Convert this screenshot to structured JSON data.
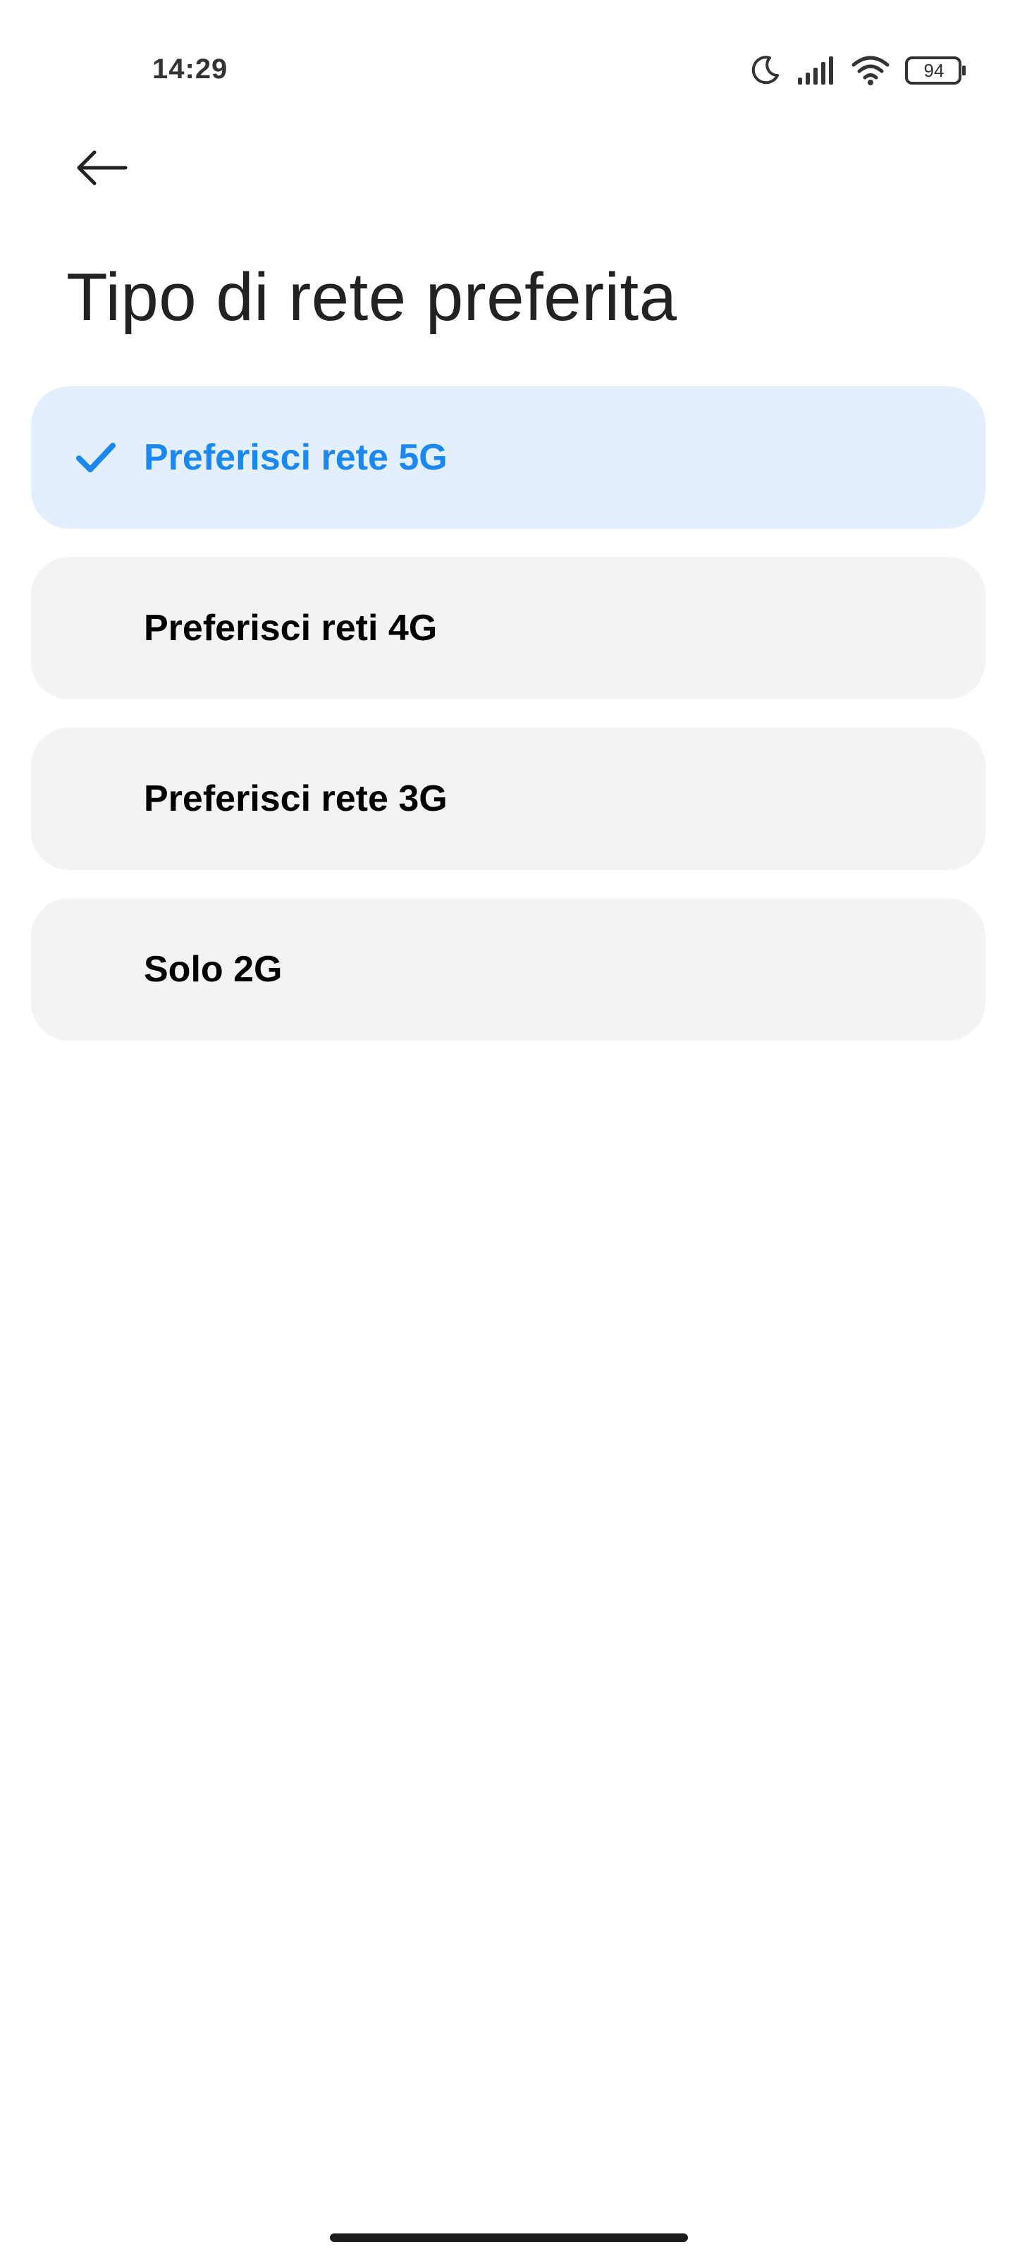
{
  "status_bar": {
    "time": "14:29",
    "battery_level": "94",
    "icons": [
      "moon-icon",
      "signal-icon",
      "wifi-icon",
      "battery-icon"
    ]
  },
  "header": {
    "back_icon": "arrow-left-icon",
    "title": "Tipo di rete preferita"
  },
  "options": [
    {
      "label": "Preferisci rete 5G",
      "selected": true
    },
    {
      "label": "Preferisci reti 4G",
      "selected": false
    },
    {
      "label": "Preferisci rete 3G",
      "selected": false
    },
    {
      "label": "Solo 2G",
      "selected": false
    }
  ],
  "colors": {
    "accent": "#1a88ee",
    "selected_background": "#e3effd",
    "option_background": "#f3f3f3",
    "background": "#ffffff"
  }
}
